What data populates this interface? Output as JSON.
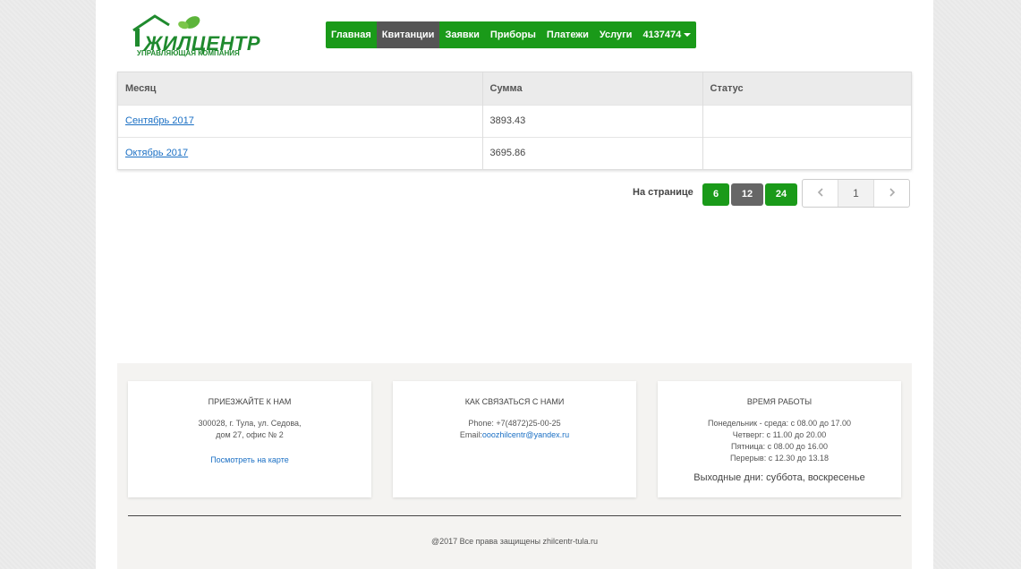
{
  "header": {
    "logo_text": "ЖИЛЦЕНТР",
    "logo_subtitle": "УПРАВЛЯЮЩАЯ КОМПАНИЯ",
    "nav": [
      "Главная",
      "Квитанции",
      "Заявки",
      "Приборы",
      "Платежи",
      "Услуги"
    ],
    "account": "4137474",
    "active_index": 1
  },
  "table": {
    "headers": [
      "Месяц",
      "Сумма",
      "Статус"
    ],
    "rows": [
      {
        "month": "Сентябрь 2017",
        "sum": "3893.43",
        "status": ""
      },
      {
        "month": "Октябрь 2017",
        "sum": "3695.86",
        "status": ""
      }
    ]
  },
  "per_page": {
    "label": "На странице",
    "options": [
      "6",
      "12",
      "24"
    ],
    "selected": "12"
  },
  "pagination": {
    "current": "1"
  },
  "footer": {
    "visit": {
      "title": "ПРИЕЗЖАЙТЕ К НАМ",
      "line1": "300028, г. Тула, ул. Седова,",
      "line2": "дом 27, офис № 2",
      "map_link": "Посмотреть на карте"
    },
    "contact": {
      "title": "КАК СВЯЗАТЬСЯ С НАМИ",
      "phone": "Phone: +7(4872)25-00-25",
      "email_label": "Email:",
      "email": "ooozhilcentr@yandex.ru"
    },
    "hours": {
      "title": "ВРЕМЯ РАБОТЫ",
      "line1": "Понедельник - среда: с 08.00 до 17.00",
      "line2": "Четверг: с 11.00 до 20.00",
      "line3": "Пятница: с 08.00 до 16.00",
      "line4": "Перерыв: с 12.30 до 13.18",
      "weekend": "Выходные дни: суббота, воскресенье"
    },
    "copyright": "@2017 Все права защищены zhilcentr-tula.ru"
  },
  "colors": {
    "brand_green": "#1a9a19",
    "active_gray": "#555555",
    "link_blue": "#1a6fc4"
  },
  "icons": [
    "house-leaf-logo-icon",
    "caret-down-icon",
    "chevron-left-icon",
    "chevron-right-icon"
  ]
}
